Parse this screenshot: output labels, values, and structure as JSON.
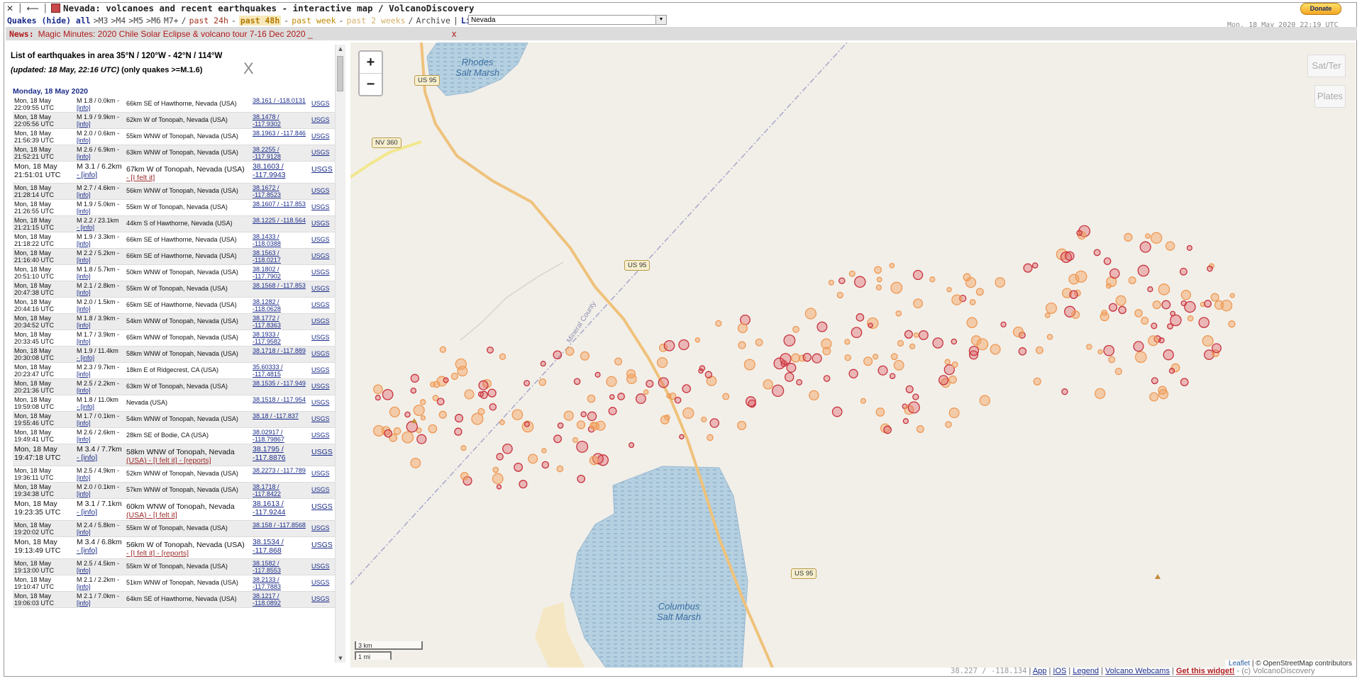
{
  "window": {
    "title": "Nevada: volcanoes and recent earthquakes - interactive map / VolcanoDiscovery",
    "donate_label": "Donate",
    "timestamp": "Mon, 18 May 2020 22:19 UTC"
  },
  "filters": {
    "quakes_label": "Quakes (hide) all",
    "m3": ">M3",
    "m4": ">M4",
    "m5": ">M5",
    "m6": ">M6",
    "m7": "M7+",
    "past24h": "past 24h",
    "past48h": "past 48h",
    "pastweek": "past week",
    "past2weeks": "past 2 weeks",
    "archive": "Archive",
    "list": "List",
    "region_value": "Nevada"
  },
  "news": {
    "label": "News:",
    "text": "Magic Minutes: 2020 Chile Solar Eclipse & volcano tour 7-16 Dec 2020 _",
    "close": "x"
  },
  "panel": {
    "title": "List of earthquakes in area 35°N / 120°W - 42°N / 114°W",
    "subtitle_italic": "(updated: 18 May, 22:16 UTC)",
    "subtitle_rest": " (only quakes >=M.1.6)",
    "close_label": "X",
    "day_heading": "Monday, 18 May 2020",
    "rows": [
      {
        "date": "Mon, 18 May",
        "time": "22:09:55 UTC",
        "mag": "M 1.8 / 0.0km -",
        "info": "[info]",
        "extra": "",
        "loc": "66km SE of Hawthorne, Nevada (USA)",
        "c1": "38.161 / -118.0131",
        "c2": "",
        "src": "USGS",
        "big": false
      },
      {
        "date": "Mon, 18 May",
        "time": "22:05:56 UTC",
        "mag": "M 1.9 / 9.9km -",
        "info": "[info]",
        "extra": "",
        "loc": "62km W of Tonopah, Nevada (USA)",
        "c1": "38.1478 /",
        "c2": "-117.9302",
        "src": "USGS",
        "big": false
      },
      {
        "date": "Mon, 18 May",
        "time": "21:56:39 UTC",
        "mag": "M 2.0 / 0.6km -",
        "info": "[info]",
        "extra": "",
        "loc": "55km WNW of Tonopah, Nevada (USA)",
        "c1": "38.1963 / -117.846",
        "c2": "",
        "src": "USGS",
        "big": false
      },
      {
        "date": "Mon, 18 May",
        "time": "21:52:21 UTC",
        "mag": "M 2.6 / 6.9km -",
        "info": "[info]",
        "extra": "",
        "loc": "63km WNW of Tonopah, Nevada (USA)",
        "c1": "38.2255 /",
        "c2": "-117.9128",
        "src": "USGS",
        "big": false
      },
      {
        "date": "Mon, 18 May",
        "time": "21:51:01 UTC",
        "mag": "M 3.1 / 6.2km",
        "info": "- [info]",
        "extra": "- [I felt it]",
        "loc": "67km W of Tonopah, Nevada (USA)",
        "c1": "38.1603 /",
        "c2": "-117.9943",
        "src": "USGS",
        "big": true
      },
      {
        "date": "Mon, 18 May",
        "time": "21:28:14 UTC",
        "mag": "M 2.7 / 4.6km -",
        "info": "[info]",
        "extra": "",
        "loc": "56km WNW of Tonopah, Nevada (USA)",
        "c1": "38.1672 /",
        "c2": "-117.8523",
        "src": "USGS",
        "big": false
      },
      {
        "date": "Mon, 18 May",
        "time": "21:26:55 UTC",
        "mag": "M 1.9 / 5.0km -",
        "info": "[info]",
        "extra": "",
        "loc": "55km W of Tonopah, Nevada (USA)",
        "c1": "38.1607 / -117.853",
        "c2": "",
        "src": "USGS",
        "big": false
      },
      {
        "date": "Mon, 18 May",
        "time": "21:21:15 UTC",
        "mag": "M 2.2 / 23.1km",
        "info": "- [info]",
        "extra": "",
        "loc": "44km S of Hawthorne, Nevada (USA)",
        "c1": "38.1225 / -118.564",
        "c2": "",
        "src": "USGS",
        "big": false
      },
      {
        "date": "Mon, 18 May",
        "time": "21:18:22 UTC",
        "mag": "M 1.9 / 3.3km -",
        "info": "[info]",
        "extra": "",
        "loc": "66km SE of Hawthorne, Nevada (USA)",
        "c1": "38.1433 /",
        "c2": "-118.0388",
        "src": "USGS",
        "big": false
      },
      {
        "date": "Mon, 18 May",
        "time": "21:16:40 UTC",
        "mag": "M 2.2 / 5.2km -",
        "info": "[info]",
        "extra": "",
        "loc": "66km SE of Hawthorne, Nevada (USA)",
        "c1": "38.1563 /",
        "c2": "-118.0217",
        "src": "USGS",
        "big": false
      },
      {
        "date": "Mon, 18 May",
        "time": "20:51:10 UTC",
        "mag": "M 1.8 / 5.7km -",
        "info": "[info]",
        "extra": "",
        "loc": "50km WNW of Tonopah, Nevada (USA)",
        "c1": "38.1802 /",
        "c2": "-117.7902",
        "src": "USGS",
        "big": false
      },
      {
        "date": "Mon, 18 May",
        "time": "20:47:38 UTC",
        "mag": "M 2.1 / 2.8km -",
        "info": "[info]",
        "extra": "",
        "loc": "55km W of Tonopah, Nevada (USA)",
        "c1": "38.1568 / -117.853",
        "c2": "",
        "src": "USGS",
        "big": false
      },
      {
        "date": "Mon, 18 May",
        "time": "20:44:16 UTC",
        "mag": "M 2.0 / 1.5km -",
        "info": "[info]",
        "extra": "",
        "loc": "65km SE of Hawthorne, Nevada (USA)",
        "c1": "38.1282 /",
        "c2": "-118.0628",
        "src": "USGS",
        "big": false
      },
      {
        "date": "Mon, 18 May",
        "time": "20:34:52 UTC",
        "mag": "M 1.8 / 3.9km -",
        "info": "[info]",
        "extra": "",
        "loc": "54km WNW of Tonopah, Nevada (USA)",
        "c1": "38.1772 /",
        "c2": "-117.8363",
        "src": "USGS",
        "big": false
      },
      {
        "date": "Mon, 18 May",
        "time": "20:33:45 UTC",
        "mag": "M 1.7 / 3.9km -",
        "info": "[info]",
        "extra": "",
        "loc": "65km WNW of Tonopah, Nevada (USA)",
        "c1": "38.1933 /",
        "c2": "-117.9582",
        "src": "USGS",
        "big": false
      },
      {
        "date": "Mon, 18 May",
        "time": "20:30:08 UTC",
        "mag": "M 1.9 / 11.4km",
        "info": "- [info]",
        "extra": "",
        "loc": "58km WNW of Tonopah, Nevada (USA)",
        "c1": "38.1718 / -117.889",
        "c2": "",
        "src": "USGS",
        "big": false
      },
      {
        "date": "Mon, 18 May",
        "time": "20:23:47 UTC",
        "mag": "M 2.3 / 9.7km -",
        "info": "[info]",
        "extra": "",
        "loc": "18km E of Ridgecrest, CA (USA)",
        "c1": "35.60333 /",
        "c2": "-117.4815",
        "src": "USGS",
        "big": false
      },
      {
        "date": "Mon, 18 May",
        "time": "20:21:36 UTC",
        "mag": "M 2.5 / 2.2km -",
        "info": "[info]",
        "extra": "",
        "loc": "63km W of Tonopah, Nevada (USA)",
        "c1": "38.1535 / -117.949",
        "c2": "",
        "src": "USGS",
        "big": false
      },
      {
        "date": "Mon, 18 May",
        "time": "19:59:08 UTC",
        "mag": "M 1.8 / 11.0km",
        "info": "- [info]",
        "extra": "",
        "loc": "Nevada (USA)",
        "c1": "38.1518 / -117.954",
        "c2": "",
        "src": "USGS",
        "big": false
      },
      {
        "date": "Mon, 18 May",
        "time": "19:55:46 UTC",
        "mag": "M 1.7 / 0.1km -",
        "info": "[info]",
        "extra": "",
        "loc": "54km WNW of Tonopah, Nevada (USA)",
        "c1": "38.18 / -117.837",
        "c2": "",
        "src": "USGS",
        "big": false
      },
      {
        "date": "Mon, 18 May",
        "time": "19:49:41 UTC",
        "mag": "M 2.6 / 2.6km -",
        "info": "[info]",
        "extra": "",
        "loc": "28km SE of Bodie, CA (USA)",
        "c1": "38.02917 /",
        "c2": "-118.79867",
        "src": "USGS",
        "big": false
      },
      {
        "date": "Mon, 18 May",
        "time": "19:47:18 UTC",
        "mag": "M 3.4 / 7.7km",
        "info": "- [info]",
        "extra": "(USA) - [I felt it] - [reports]",
        "loc": "58km WNW of Tonopah, Nevada",
        "c1": "38.1795 /",
        "c2": "-117.8876",
        "src": "USGS",
        "big": true
      },
      {
        "date": "Mon, 18 May",
        "time": "19:36:11 UTC",
        "mag": "M 2.5 / 4.9km -",
        "info": "[info]",
        "extra": "",
        "loc": "52km WNW of Tonopah, Nevada (USA)",
        "c1": "38.2273 / -117.789",
        "c2": "",
        "src": "USGS",
        "big": false
      },
      {
        "date": "Mon, 18 May",
        "time": "19:34:38 UTC",
        "mag": "M 2.0 / 0.1km -",
        "info": "[info]",
        "extra": "",
        "loc": "57km WNW of Tonopah, Nevada (USA)",
        "c1": "38.1718 /",
        "c2": "-117.8422",
        "src": "USGS",
        "big": false
      },
      {
        "date": "Mon, 18 May",
        "time": "19:23:35 UTC",
        "mag": "M 3.1 / 7.1km",
        "info": "- [info]",
        "extra": "(USA) - [I felt it]",
        "loc": "60km WNW of Tonopah, Nevada",
        "c1": "38.1613 /",
        "c2": "-117.9244",
        "src": "USGS",
        "big": true
      },
      {
        "date": "Mon, 18 May",
        "time": "19:20:02 UTC",
        "mag": "M 2.4 / 5.8km -",
        "info": "[info]",
        "extra": "",
        "loc": "55km W of Tonopah, Nevada (USA)",
        "c1": "38.158 / -117.8568",
        "c2": "",
        "src": "USGS",
        "big": false
      },
      {
        "date": "Mon, 18 May",
        "time": "19:13:49 UTC",
        "mag": "M 3.4 / 6.8km",
        "info": "- [info]",
        "extra": "- [I felt it] - [reports]",
        "loc": "56km W of Tonopah, Nevada (USA)",
        "c1": "38.1534 /",
        "c2": "-117.868",
        "src": "USGS",
        "big": true
      },
      {
        "date": "Mon, 18 May",
        "time": "19:13:00 UTC",
        "mag": "M 2.5 / 4.5km -",
        "info": "[info]",
        "extra": "",
        "loc": "55km W of Tonopah, Nevada (USA)",
        "c1": "38.1582 /",
        "c2": "-117.8553",
        "src": "USGS",
        "big": false
      },
      {
        "date": "Mon, 18 May",
        "time": "19:10:47 UTC",
        "mag": "M 2.1 / 2.2km -",
        "info": "[info]",
        "extra": "",
        "loc": "51km WNW of Tonopah, Nevada (USA)",
        "c1": "38.2133 /",
        "c2": "-117.7883",
        "src": "USGS",
        "big": false
      },
      {
        "date": "Mon, 18 May",
        "time": "19:06:03 UTC",
        "mag": "M 2.1 / 7.0km -",
        "info": "[info]",
        "extra": "",
        "loc": "64km SE of Hawthorne, Nevada (USA)",
        "c1": "38.1217 /",
        "c2": "-118.0892",
        "src": "USGS",
        "big": false
      }
    ]
  },
  "map": {
    "zoom_in": "+",
    "zoom_out": "−",
    "sat_ter": "Sat/Ter",
    "plates": "Plates",
    "labels": {
      "rhodes1": "Rhodes",
      "rhodes2": "Salt Marsh",
      "columbus1": "Columbus",
      "columbus2": "Salt Marsh",
      "us95_a": "US 95",
      "us95_b": "US 95",
      "us95_c": "US 95",
      "nv360": "NV 360",
      "county": "Mineral County"
    },
    "scale_km": "3 km",
    "scale_mi": "1 mi",
    "attribution_leaflet": "Leaflet",
    "attribution_osm": "© OpenStreetMap contributors"
  },
  "footer": {
    "coords": "38.227 / -118.134",
    "app": "App",
    "ios": "IOS",
    "legend": "Legend",
    "webcams": "Volcano Webcams",
    "widget": "Get this widget!",
    "brand": "- (c) VolcanoDiscovery"
  }
}
